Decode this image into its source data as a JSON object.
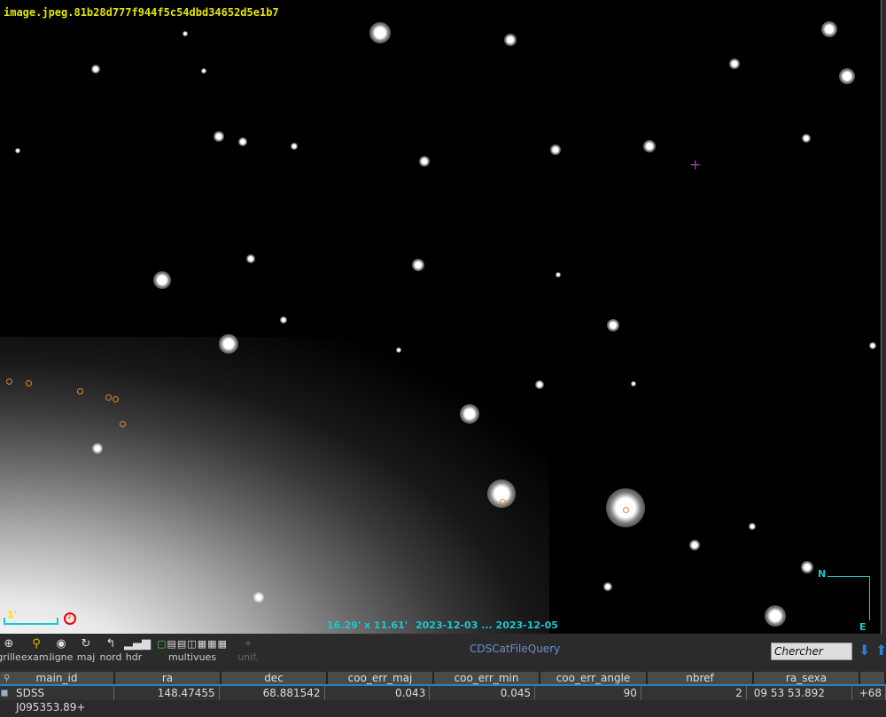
{
  "image_title": "image.jpeg.81b28d777f944f5c54dbd34652d5e1b7",
  "overlay": {
    "scale_label": "1'",
    "fov": "16.29' x 11.61'",
    "date_range": "2023-12-03 ... 2023-12-05",
    "north": "N",
    "east": "E"
  },
  "toolbar": {
    "items": [
      {
        "label": "grille",
        "icon": "globe-icon"
      },
      {
        "label": "exam.",
        "icon": "magnifier-icon"
      },
      {
        "label": "ligne",
        "icon": "eye-icon"
      },
      {
        "label": "maj",
        "icon": "refresh-icon"
      },
      {
        "label": "nord",
        "icon": "north-arrow-icon"
      },
      {
        "label": "hdr",
        "icon": "histogram-icon"
      }
    ],
    "multiview_label": "multivues",
    "unif_label": "unif.",
    "query_name": "CDSCatFileQuery",
    "search_placeholder": "Chercher"
  },
  "table": {
    "columns": [
      "main_id",
      "ra",
      "dec",
      "coo_err_maj",
      "coo_err_min",
      "coo_err_angle",
      "nbref",
      "ra_sexa",
      ""
    ],
    "rows": [
      [
        "SDSS J095353.89+",
        "148.47455",
        "68.881542",
        "0.043",
        "0.045",
        "90",
        "2",
        "09 53 53.892",
        "+68"
      ]
    ]
  },
  "colors": {
    "title": "#e6e600",
    "overlay": "#19c9d0",
    "marker": "#e08a2a",
    "query": "#6d8fd0"
  }
}
